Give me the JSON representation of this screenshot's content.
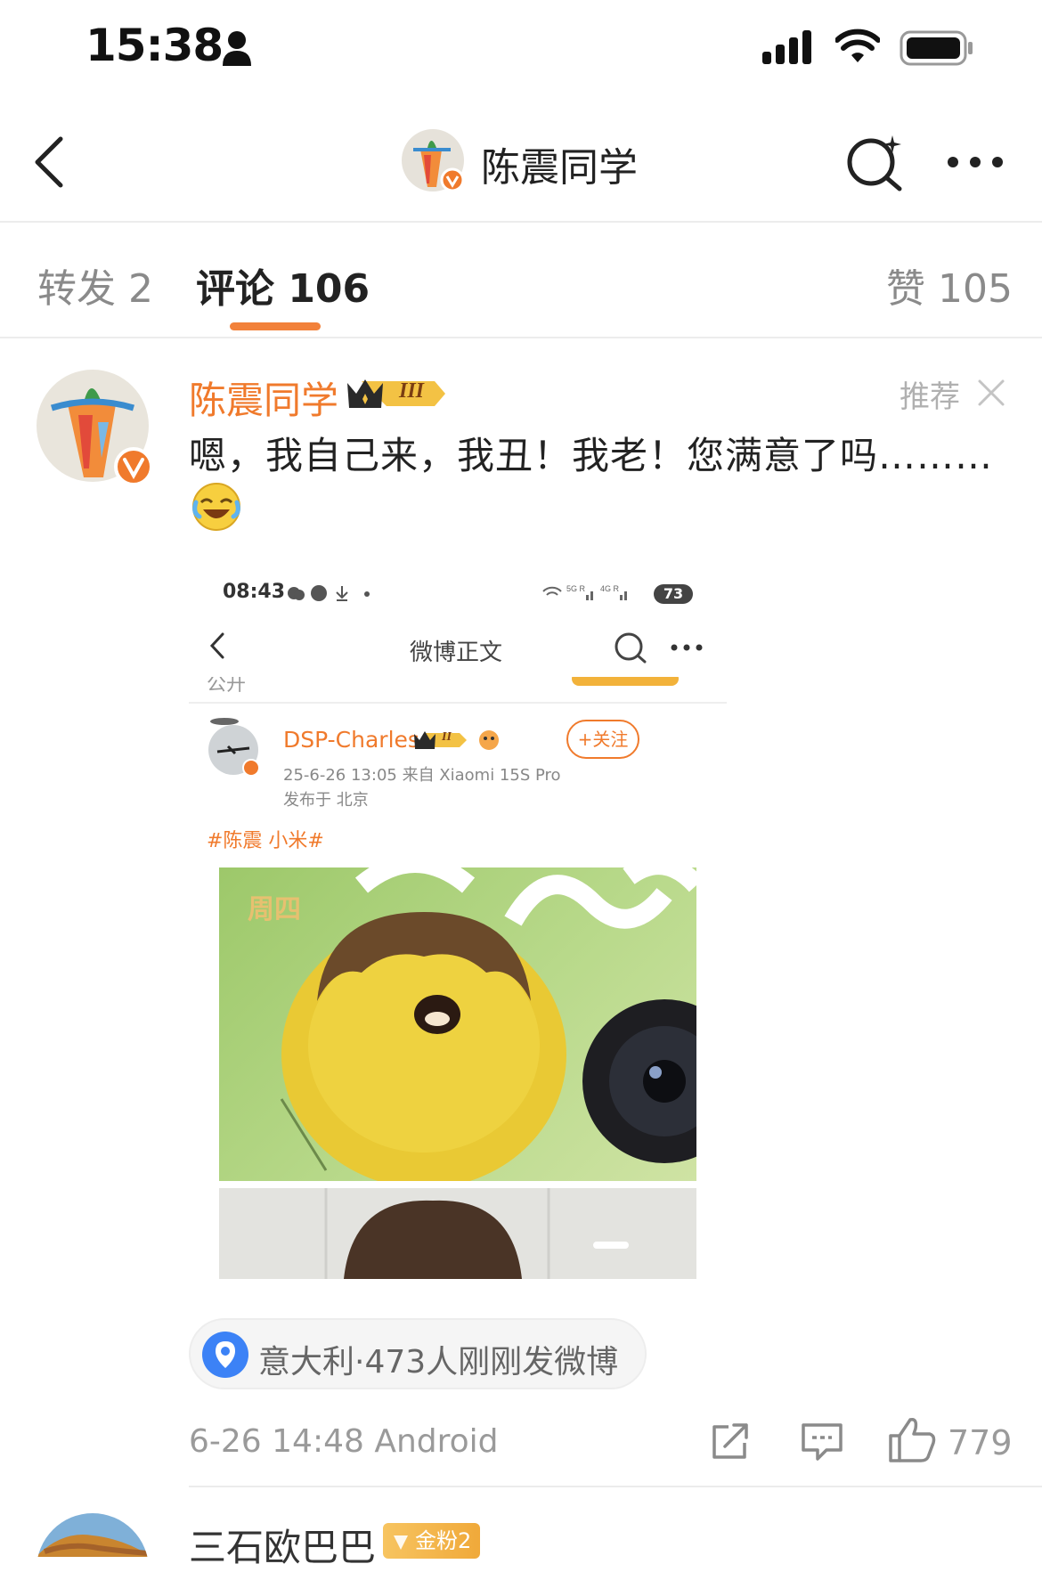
{
  "status_bar": {
    "time": "15:38"
  },
  "nav": {
    "title": "陈震同学"
  },
  "tabs": [
    {
      "label": "转发 2"
    },
    {
      "label": "评论 106"
    },
    {
      "label": "赞 105"
    }
  ],
  "comment": {
    "username": "陈震同学",
    "level_badge": "III",
    "recommend_label": "推荐",
    "text": "嗯，我自己来，我丑！我老！您满意了吗………",
    "emoji": "😂",
    "screenshot": {
      "status_time": "08:43",
      "battery": "73",
      "page_title": "微博正文",
      "clipped_line": "公开",
      "author": "DSP-Charles",
      "author_badge": "II",
      "follow_label": "+关注",
      "post_meta": "25-6-26 13:05  来自 Xiaomi 15S Pro",
      "post_location": "发布于 北京",
      "hashtag": "#陈震 小米#",
      "image_overlay_text": "周四"
    },
    "location_tag": "意大利·473人刚刚发微博",
    "time_source": "6-26 14:48  Android",
    "like_count": "779"
  },
  "next_comment": {
    "username": "三石欧巴巴",
    "fan_badge": "金粉2"
  },
  "colors": {
    "accent": "#f07a2c",
    "tab_underline": "#f2813a",
    "location_blue": "#3c82f6"
  }
}
